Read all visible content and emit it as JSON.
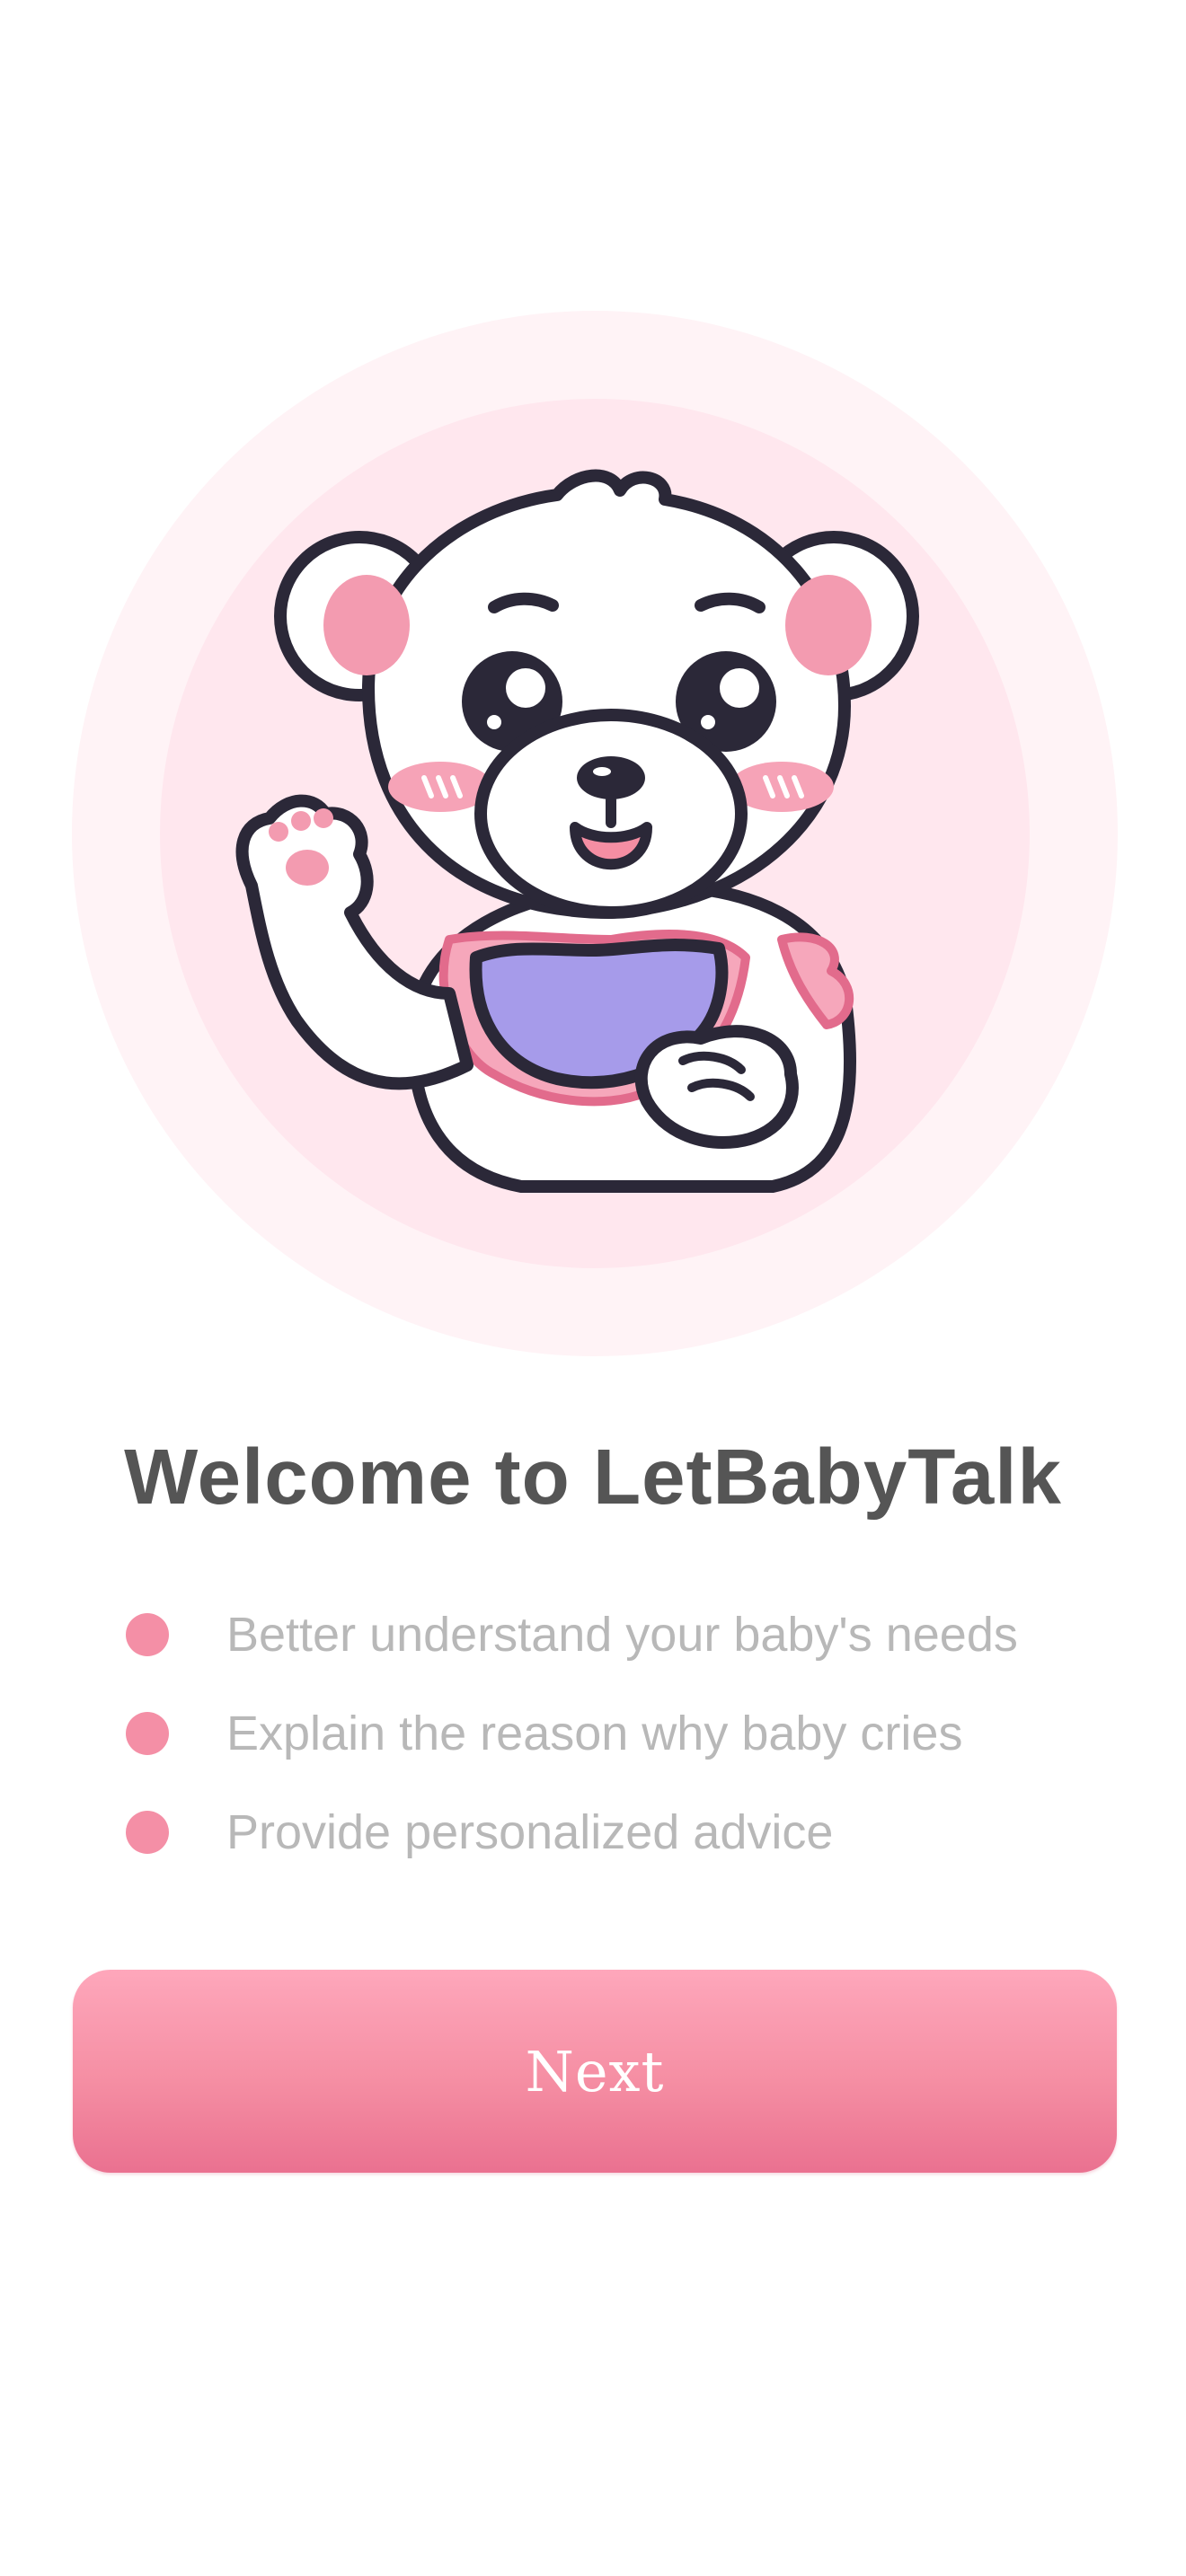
{
  "onboarding": {
    "title": "Welcome to LetBabyTalk",
    "features": [
      "Better understand your baby's needs",
      "Explain the reason why baby cries",
      "Provide personalized advice"
    ],
    "next_label": "Next"
  },
  "colors": {
    "accent": "#f48fa6",
    "title": "#555555",
    "feature_text": "#b8b8b8",
    "button_top": "#fea7bb",
    "button_bottom": "#ea7190",
    "outer_circle": "#fff3f6",
    "inner_circle": "#ffe7ee",
    "bib": "#a69bea"
  },
  "icons": {
    "mascot": "waving-bear-illustration",
    "bullet": "pink-dot-icon"
  }
}
